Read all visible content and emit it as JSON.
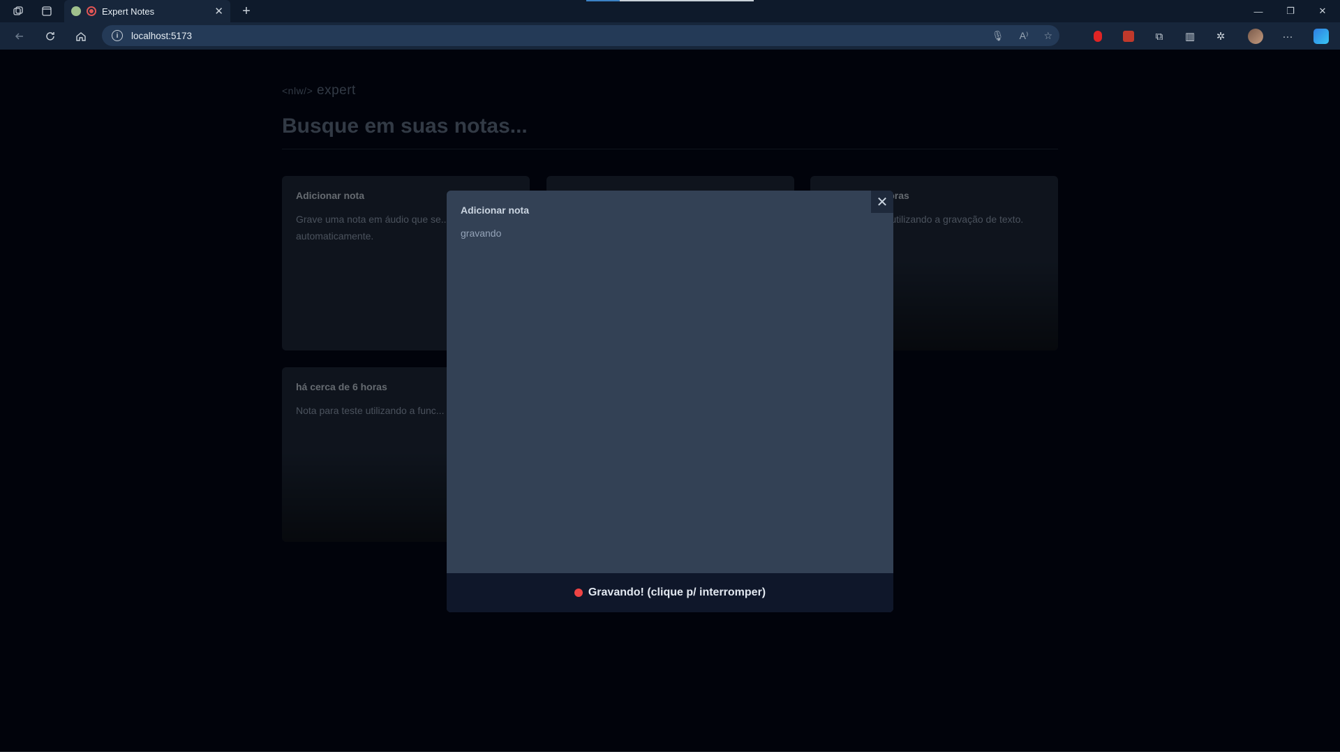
{
  "browser": {
    "tab_title": "Expert Notes",
    "url": "localhost:5173",
    "new_tab_glyph": "+",
    "tab_close_glyph": "✕"
  },
  "page": {
    "logo_prefix": "<nlw/>",
    "logo_word": "expert",
    "search_placeholder": "Busque em suas notas...",
    "cards": [
      {
        "title": "Adicionar nota",
        "text": "Grave uma nota em áudio que se... para texto automaticamente."
      },
      {
        "title": "",
        "text": ""
      },
      {
        "title": "...horas",
        "text": "...e utilizando a gravação de texto."
      },
      {
        "title": "há cerca de 6 horas",
        "text": "Nota para teste utilizando a func... escrita de texto"
      }
    ]
  },
  "modal": {
    "title": "Adicionar nota",
    "body": "gravando",
    "footer_label": "Gravando! (clique p/ interromper)",
    "close_glyph": "✕"
  },
  "colors": {
    "page_bg": "#020617",
    "modal_bg": "#334155",
    "footer_bg": "#0f172a",
    "recording_dot": "#ef4444"
  },
  "icons": [
    "workspaces-icon",
    "tab-actions-icon",
    "back-icon",
    "refresh-icon",
    "home-icon",
    "info-icon",
    "microphone-icon",
    "read-aloud-icon",
    "favorite-star-icon",
    "extension-icon",
    "split-screen-icon",
    "collections-icon",
    "profile-avatar",
    "more-icon",
    "copilot-icon",
    "close-icon",
    "recording-icon"
  ]
}
